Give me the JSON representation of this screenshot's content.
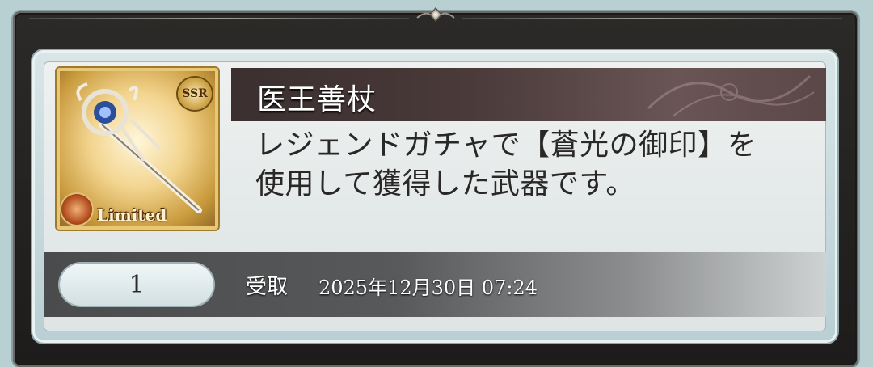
{
  "item": {
    "title": "医王善杖",
    "description": "レジェンドガチャで【蒼光の御印】を\n使用して獲得した武器です。",
    "rarity_badge": "SSR",
    "limited_label": "Limited",
    "thumbnail_icon": "staff-weapon-icon"
  },
  "footer": {
    "count": "1",
    "received_label": "受取",
    "received_datetime": "2025年12月30日 07:24"
  },
  "colors": {
    "title_bar": "#3b2f2f",
    "card_bg": "#e3e8e8",
    "footer_bar": "#4a4b4c",
    "frame": "#2c2a28"
  }
}
